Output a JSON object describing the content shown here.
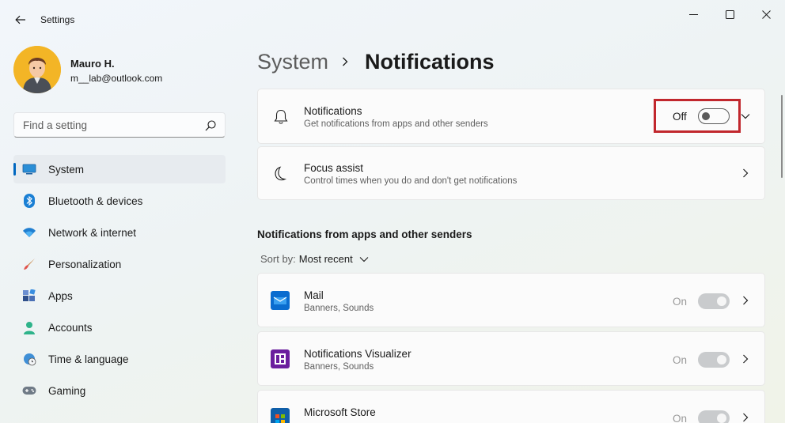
{
  "window": {
    "title": "Settings"
  },
  "user": {
    "name": "Mauro H.",
    "email": "m__lab@outlook.com"
  },
  "search": {
    "placeholder": "Find a setting"
  },
  "sidebar": {
    "items": [
      {
        "label": "System",
        "icon": "monitor-icon",
        "active": true
      },
      {
        "label": "Bluetooth & devices",
        "icon": "bluetooth-icon"
      },
      {
        "label": "Network & internet",
        "icon": "wifi-icon"
      },
      {
        "label": "Personalization",
        "icon": "paintbrush-icon"
      },
      {
        "label": "Apps",
        "icon": "apps-icon"
      },
      {
        "label": "Accounts",
        "icon": "person-icon"
      },
      {
        "label": "Time & language",
        "icon": "globe-clock-icon"
      },
      {
        "label": "Gaming",
        "icon": "gamepad-icon"
      }
    ]
  },
  "breadcrumb": {
    "parent": "System",
    "current": "Notifications"
  },
  "notifications_card": {
    "title": "Notifications",
    "subtitle": "Get notifications from apps and other senders",
    "toggle_label": "Off",
    "toggle_on": false
  },
  "focus_card": {
    "title": "Focus assist",
    "subtitle": "Control times when you do and don't get notifications"
  },
  "apps_section": {
    "title": "Notifications from apps and other senders",
    "sort_label": "Sort by:",
    "sort_value": "Most recent",
    "apps": [
      {
        "name": "Mail",
        "detail": "Banners, Sounds",
        "state": "On"
      },
      {
        "name": "Notifications Visualizer",
        "detail": "Banners, Sounds",
        "state": "On"
      },
      {
        "name": "Microsoft Store",
        "detail": "",
        "state": "On"
      }
    ]
  },
  "colors": {
    "accent": "#0067c0",
    "highlight": "#c1272d"
  }
}
